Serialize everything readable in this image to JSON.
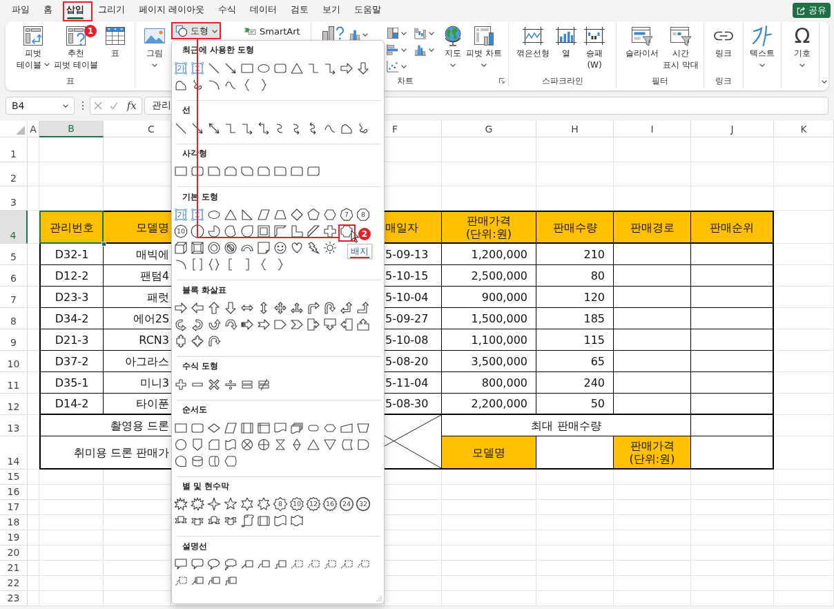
{
  "menu_tabs": [
    {
      "label": "파일",
      "selected": false
    },
    {
      "label": "홈",
      "selected": false
    },
    {
      "label": "삽입",
      "selected": true
    },
    {
      "label": "그리기",
      "selected": false
    },
    {
      "label": "페이지 레이아웃",
      "selected": false
    },
    {
      "label": "수식",
      "selected": false
    },
    {
      "label": "데이터",
      "selected": false
    },
    {
      "label": "검토",
      "selected": false
    },
    {
      "label": "보기",
      "selected": false
    },
    {
      "label": "도움말",
      "selected": false
    }
  ],
  "share_button": {
    "label": "공유"
  },
  "ribbon": {
    "table_group": {
      "label": "표",
      "buttons": [
        {
          "label": "피벗\n테이블"
        },
        {
          "label": "추천\n피벗 테이블"
        },
        {
          "label": "표"
        }
      ]
    },
    "illustrations": {
      "picture": {
        "label": "그림"
      },
      "shapes": {
        "label": "도형",
        "expanded": true
      },
      "smartart": {
        "label": "SmartArt"
      }
    },
    "chart_group": {
      "label": "차트",
      "buttons": [
        {
          "label": "지도"
        },
        {
          "label": "피벗 차트"
        }
      ]
    },
    "sparkline_group": {
      "label": "스파크라인",
      "buttons": [
        {
          "label": "꺾은선형"
        },
        {
          "label": "열"
        },
        {
          "label": "승패\n(W)"
        }
      ]
    },
    "filter_group": {
      "label": "필터",
      "buttons": [
        {
          "label": "슬라이서"
        },
        {
          "label": "시간\n표시 막대"
        }
      ]
    },
    "link_group": {
      "label": "링크",
      "buttons": [
        {
          "label": "링크"
        }
      ]
    },
    "text_button": {
      "label": "텍스트"
    },
    "symbol_button": {
      "label": "기호",
      "glyph": "Ω"
    }
  },
  "shapes_menu": {
    "sections": [
      {
        "title": "최근에 사용한 도형",
        "shape_labels": [
          "가"
        ]
      },
      {
        "title": "선"
      },
      {
        "title": "사각형"
      },
      {
        "title": "기본 도형",
        "shape_labels": [
          "가",
          "7",
          "8",
          "10"
        ]
      },
      {
        "title": "블록 화살표"
      },
      {
        "title": "수식 도형"
      },
      {
        "title": "순서도"
      },
      {
        "title": "별 및 현수막",
        "shape_labels": [
          "8",
          "10",
          "12",
          "16",
          "24",
          "32"
        ]
      },
      {
        "title": "설명선"
      }
    ],
    "tooltip": "배지"
  },
  "formula_bar": {
    "name_box": "B4",
    "function_button": "fx",
    "value": "관리"
  },
  "sheet": {
    "column_headers": [
      {
        "label": "A",
        "selected": false
      },
      {
        "label": "B",
        "selected": true
      },
      {
        "label": "C",
        "selected": false
      },
      {
        "label": "F",
        "selected": false
      },
      {
        "label": "G",
        "selected": false
      },
      {
        "label": "H",
        "selected": false
      },
      {
        "label": "I",
        "selected": false
      },
      {
        "label": "J",
        "selected": false
      },
      {
        "label": "K",
        "selected": false
      }
    ],
    "row_headers": [
      {
        "label": "1",
        "selected": false
      },
      {
        "label": "2",
        "selected": false
      },
      {
        "label": "3",
        "selected": false
      },
      {
        "label": "4",
        "selected": true
      },
      {
        "label": "5",
        "selected": false
      },
      {
        "label": "6",
        "selected": false
      },
      {
        "label": "7",
        "selected": false
      },
      {
        "label": "8",
        "selected": false
      },
      {
        "label": "9",
        "selected": false
      },
      {
        "label": "10",
        "selected": false
      },
      {
        "label": "11",
        "selected": false
      },
      {
        "label": "12",
        "selected": false
      },
      {
        "label": "13",
        "selected": false
      },
      {
        "label": "14",
        "selected": false
      },
      {
        "label": "15",
        "selected": false
      },
      {
        "label": "16",
        "selected": false
      },
      {
        "label": "17",
        "selected": false
      },
      {
        "label": "18",
        "selected": false
      },
      {
        "label": "19",
        "selected": false
      },
      {
        "label": "20",
        "selected": false
      },
      {
        "label": "21",
        "selected": false
      },
      {
        "label": "22",
        "selected": false
      },
      {
        "label": "23",
        "selected": false
      }
    ]
  },
  "table": {
    "header": [
      {
        "text": "관리번호",
        "selected": true
      },
      {
        "text": "모델명",
        "selected": false
      },
      {
        "text": "매일자",
        "selected": false
      },
      {
        "text": "판매가격\n(단위:원)",
        "selected": false
      },
      {
        "text": "판매수량",
        "selected": false
      },
      {
        "text": "판매경로",
        "selected": false
      },
      {
        "text": "판매순위",
        "selected": false
      }
    ],
    "rows": [
      [
        "D32-1",
        "매빅에",
        "5-09-13",
        "1,200,000",
        "210"
      ],
      [
        "D12-2",
        "팬텀4",
        "5-10-15",
        "2,500,000",
        "80"
      ],
      [
        "D23-3",
        "패럿",
        "5-10-04",
        "900,000",
        "120"
      ],
      [
        "D34-2",
        "에어2S",
        "5-09-27",
        "1,500,000",
        "185"
      ],
      [
        "D21-3",
        "RCN3",
        "5-10-08",
        "1,100,000",
        "115"
      ],
      [
        "D37-2",
        "아그라스",
        "5-08-20",
        "3,500,000",
        "65"
      ],
      [
        "D35-1",
        "미니3",
        "5-11-04",
        "800,000",
        "240"
      ],
      [
        "D14-2",
        "타이푼",
        "5-08-30",
        "2,200,000",
        "50"
      ]
    ],
    "summary": {
      "row_13": "촬영용 드론",
      "row_14": "취미용 드론 판매가",
      "heading": "최대 판매수량",
      "label_cells": [
        "모델명",
        "판매가격\n(단위:원)"
      ]
    }
  },
  "annotations": {
    "markers": [
      {
        "label": "1"
      },
      {
        "label": "2"
      }
    ]
  }
}
